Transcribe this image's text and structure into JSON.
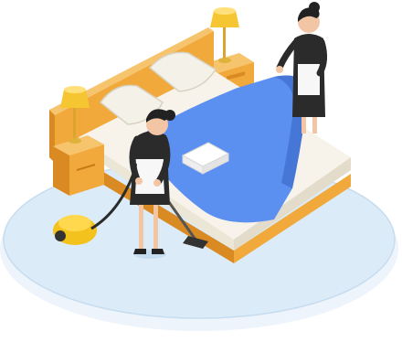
{
  "illustration": {
    "subject": "hotel-housekeeping",
    "icons": [
      "bed-icon",
      "maid-icon",
      "vacuum-cleaner-icon",
      "lamp-icon",
      "towel-icon",
      "nightstand-icon"
    ]
  },
  "colors": {
    "floor_disc": "#dcebf8",
    "floor_disc_edge": "#c6dcef",
    "bed_wood": "#f1a93b",
    "bed_wood_dark": "#d98a22",
    "bed_wood_light": "#f7c46e",
    "sheet_blue": "#5b8ff0",
    "sheet_blue_dark": "#4676d6",
    "mattress_white": "#f7f3ea",
    "pillow_white": "#f4f1e8",
    "lamp_shade": "#f6c632",
    "uniform_black": "#2b2b2b",
    "apron_white": "#f7f7f7",
    "skin": "#f2c6a4",
    "vacuum_yellow": "#f4c21c"
  }
}
